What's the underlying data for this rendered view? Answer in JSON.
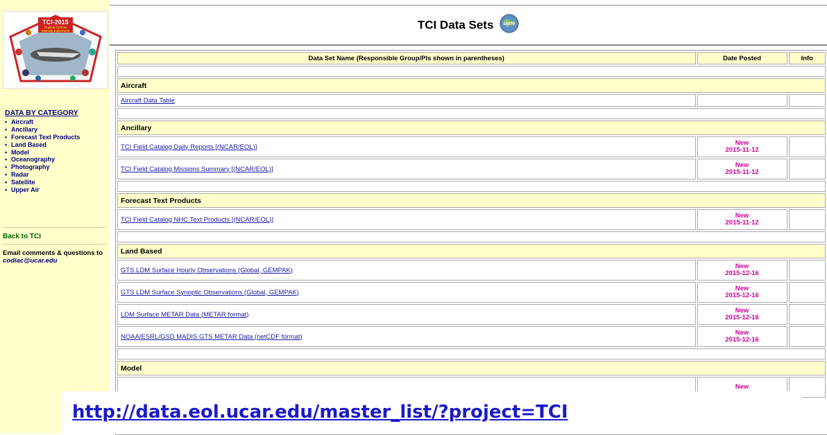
{
  "sidebar": {
    "logo_text": "TCI-2015",
    "logo_subtitle_1": "Tropical Cyclone",
    "logo_subtitle_2": "Intensity Experiment",
    "category_title": "DATA BY CATEGORY",
    "categories": [
      "Aircraft",
      "Ancillary",
      "Forecast Text Products",
      "Land Based",
      "Model",
      "Oceanography",
      "Photography",
      "Radar",
      "Satellite",
      "Upper Air"
    ],
    "back_link": "Back to TCI",
    "email_prefix": "Email comments & questions to",
    "email_address": "codiac@ucar.edu"
  },
  "header": {
    "title": "TCI Data Sets",
    "earth_icon_text": "EARTH"
  },
  "table": {
    "col_name": "Data Set Name (Responsible Group/PIs shown in parentheses)",
    "col_date": "Date Posted",
    "col_info": "Info",
    "sections": [
      {
        "name": "Aircraft",
        "rows": [
          {
            "label": "Aircraft Data Table",
            "status": "",
            "date": ""
          }
        ]
      },
      {
        "name": "Ancillary",
        "rows": [
          {
            "label": "TCI Field Catalog Daily Reports [(NCAR/EOL)]",
            "status": "New",
            "date": "2015-11-12"
          },
          {
            "label": "TCI Field Catalog Missions Summary [(NCAR/EOL)]",
            "status": "New",
            "date": "2015-11-12"
          }
        ]
      },
      {
        "name": "Forecast Text Products",
        "rows": [
          {
            "label": "TCI Field Catalog NHC Text Products [(NCAR/EOL)]",
            "status": "New",
            "date": "2015-11-12"
          }
        ]
      },
      {
        "name": "Land Based",
        "rows": [
          {
            "label": "GTS LDM Surface Hourly Observations (Global, GEMPAK)",
            "status": "New",
            "date": "2015-12-16"
          },
          {
            "label": "GTS LDM Surface Synoptic Observations (Global, GEMPAK)",
            "status": "New",
            "date": "2015-12-16"
          },
          {
            "label": "LDM Surface METAR Data (METAR format)",
            "status": "New",
            "date": "2015-12-16"
          },
          {
            "label": "NOAA/ESRL/GSD MADIS GTS METAR Data (netCDF format)",
            "status": "New",
            "date": "2015-12-16"
          }
        ]
      },
      {
        "name": "Model",
        "rows": [
          {
            "label": "",
            "status": "New",
            "date": ""
          }
        ]
      }
    ]
  },
  "overlay": {
    "url": "http://data.eol.ucar.edu/master_list/?project=TCI"
  },
  "colors": {
    "sidebar_bg": "#ffffcc",
    "link": "#1a1aa6",
    "new_date": "#cc0099",
    "overlay_url": "#1a1acc"
  }
}
